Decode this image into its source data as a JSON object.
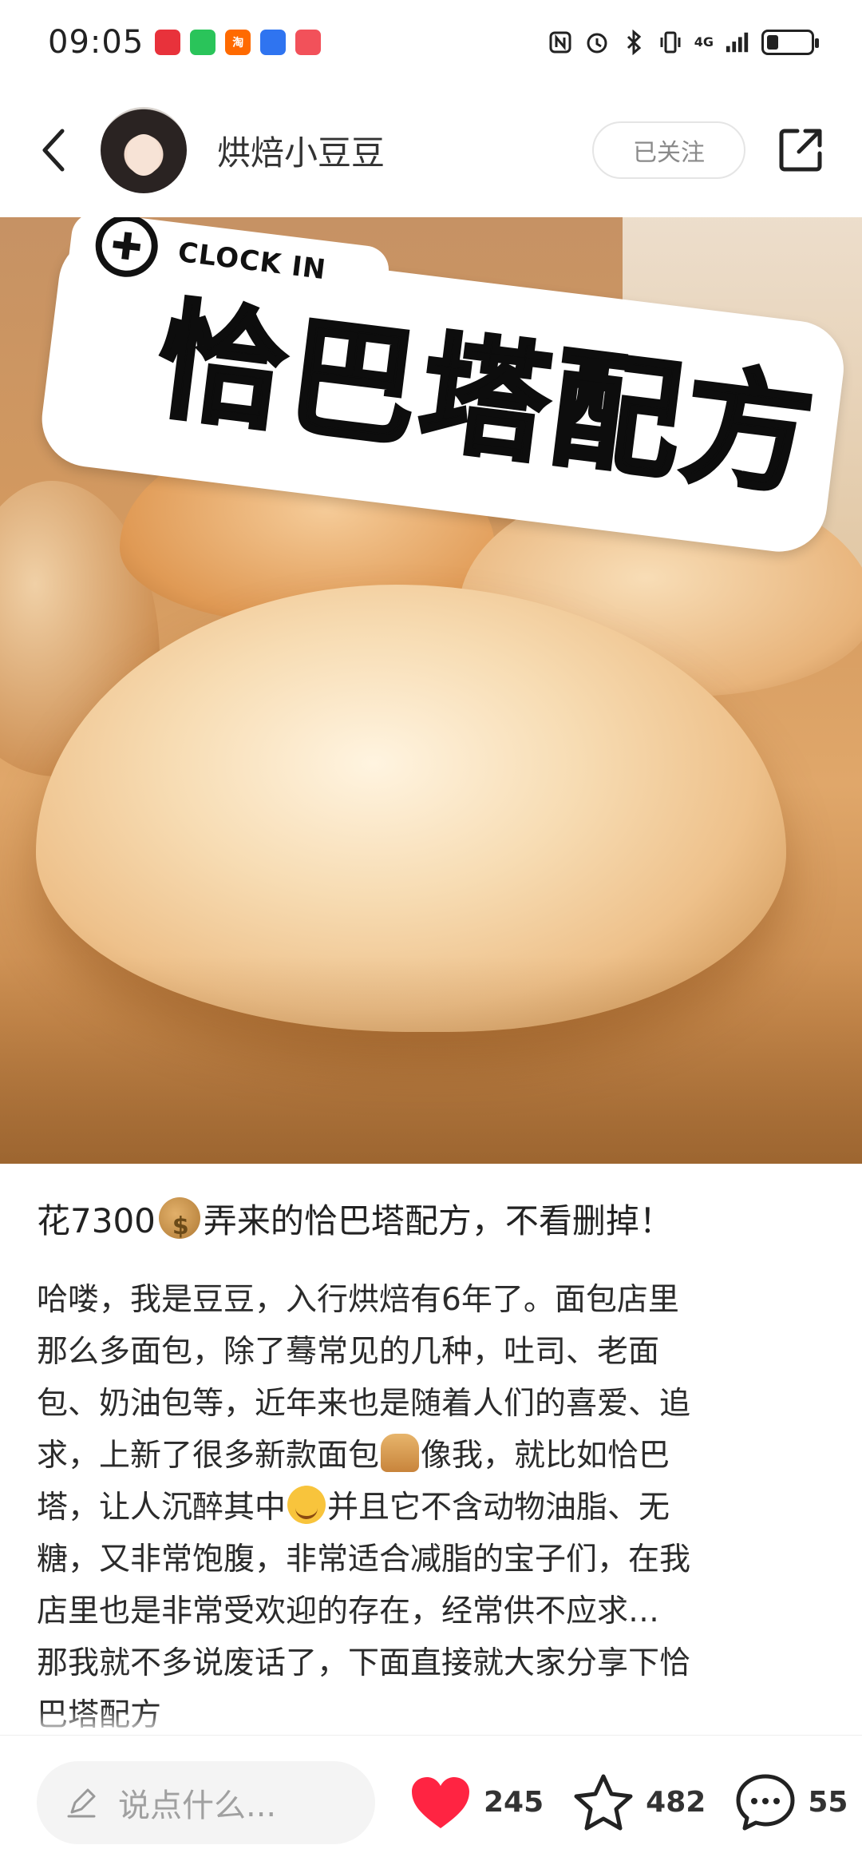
{
  "status_bar": {
    "time": "09:05",
    "notifications": [
      {
        "icon": "app-red-notification-icon",
        "color": "#e8323b"
      },
      {
        "icon": "wechat-icon",
        "color": "#2ac45a"
      },
      {
        "icon": "taobao-icon",
        "color": "#ff6a00",
        "label": "淘"
      },
      {
        "icon": "blue-app-icon",
        "color": "#2f74f0"
      },
      {
        "icon": "red-app-icon",
        "color": "#f2515a"
      }
    ],
    "network": "4G",
    "battery_level": 0.25
  },
  "header": {
    "author_name": "烘焙小豆豆",
    "follow_label": "已关注"
  },
  "hero": {
    "badge_small": "CLOCK IN",
    "badge_title": "恰巴塔配方"
  },
  "post": {
    "title_before": "花7300",
    "title_after": "弄来的恰巴塔配方，不看删掉！",
    "lines": [
      {
        "text": "哈喽，我是豆豆，入行烘焙有6年了。面包店里"
      },
      {
        "text": "那么多面包，除了蓦常见的几种，吐司、老面"
      },
      {
        "text": "包、奶油包等，近年来也是随着人们的喜爱、追"
      },
      {
        "text_a": "求，上新了很多新款面包",
        "text_b": "像我，就比如恰巴"
      },
      {
        "text_a": "塔，让人沉醉其中",
        "text_b": "并且它不含动物油脂、无"
      },
      {
        "text": "糖，又非常饱腹，非常适合减脂的宝子们，在我"
      },
      {
        "text": "店里也是非常受欢迎的存在，经常供不应求…"
      },
      {
        "text": "那我就不多说废话了，下面直接就大家分享下恰"
      },
      {
        "text": "巴塔配方"
      }
    ]
  },
  "bottom_bar": {
    "comment_placeholder": "说点什么...",
    "likes": "245",
    "stars": "482",
    "comments": "55",
    "like_color": "#ff2442"
  }
}
